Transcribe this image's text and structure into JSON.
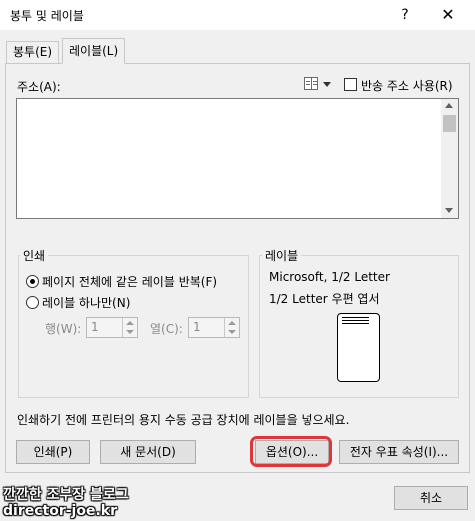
{
  "window": {
    "title": "봉투 및 레이블",
    "help_label": "?",
    "close_label": "✕"
  },
  "tabs": [
    {
      "label": "봉투(E)",
      "active": false
    },
    {
      "label": "레이블(L)",
      "active": true
    }
  ],
  "address": {
    "label": "주소(A):",
    "value": "",
    "return_address_label": "반송 주소 사용(R)",
    "return_address_checked": false,
    "address_book_icon": "address-book-icon"
  },
  "print_group": {
    "title": "인쇄",
    "option_full_page": "페이지 전체에 같은 레이블 반복(F)",
    "option_single": "레이블 하나만(N)",
    "selected": "full_page",
    "row_label": "행(W):",
    "row_value": "1",
    "col_label": "열(C):",
    "col_value": "1"
  },
  "label_group": {
    "title": "레이블",
    "line1": "Microsoft, 1/2 Letter",
    "line2": "1/2 Letter 우편 엽서"
  },
  "instruction": "인쇄하기 전에 프린터의 용지 수동 공급 장치에 레이블을 넣으세요.",
  "buttons": {
    "print": "인쇄(P)",
    "new_document": "새 문서(D)",
    "options": "옵션(O)...",
    "epostage": "전자 우표 속성(I)...",
    "cancel": "취소"
  },
  "watermark": {
    "line1": "깐깐한 조부장 블로그",
    "line2": "director-joe.kr"
  },
  "colors": {
    "highlight": "#e0363a",
    "background": "#f0f0f0"
  }
}
